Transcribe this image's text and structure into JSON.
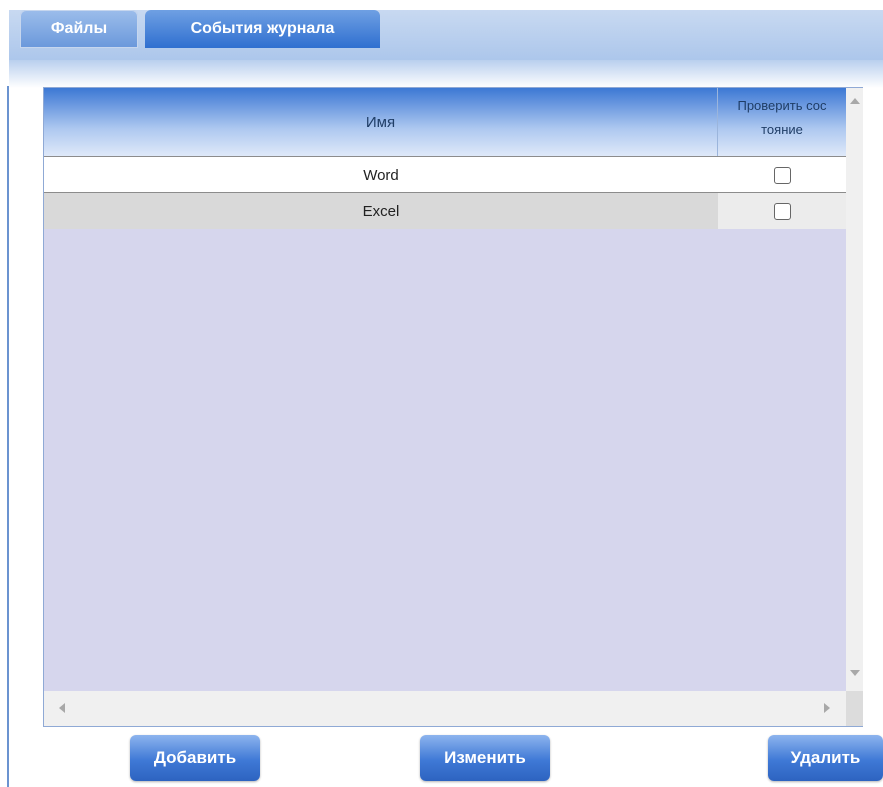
{
  "tabs": [
    {
      "label": "Файлы",
      "active": true
    },
    {
      "label": "События журнала",
      "active": false
    }
  ],
  "grid": {
    "columns": [
      "Имя",
      "Проверить сос тояние"
    ],
    "rows": [
      {
        "name": "Word",
        "checked": false
      },
      {
        "name": "Excel",
        "checked": false
      }
    ]
  },
  "buttons": {
    "add": "Добавить",
    "edit": "Изменить",
    "delete": "Удалить"
  },
  "colors": {
    "accent": "#3f79d6",
    "grid_background": "#d6d6ed"
  }
}
